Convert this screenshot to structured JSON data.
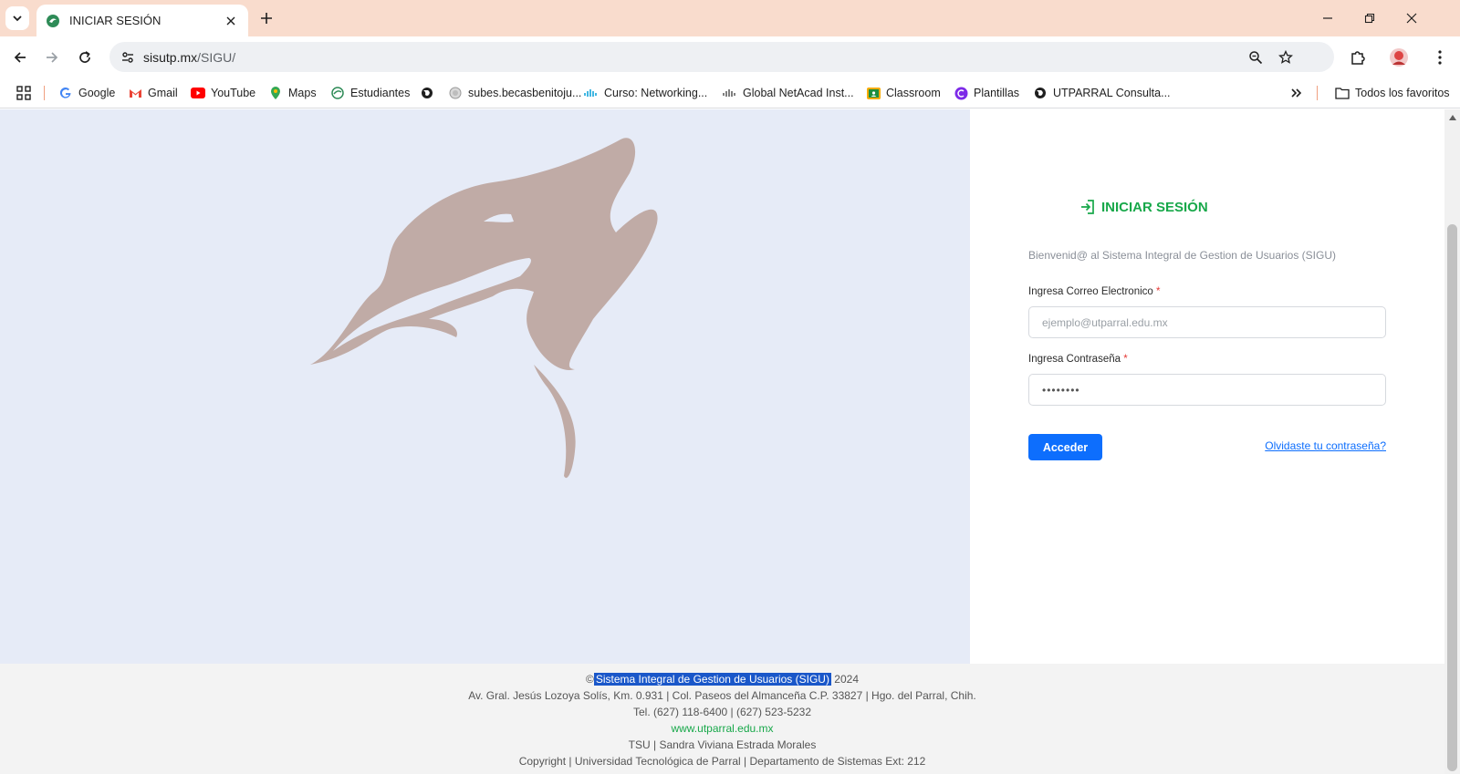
{
  "browser": {
    "tab_title": "INICIAR SESIÓN",
    "url_host": "sisutp.mx",
    "url_path": "/SIGU/",
    "bookmarks": [
      {
        "label": "Google",
        "icon": "google-icon"
      },
      {
        "label": "Gmail",
        "icon": "gmail-icon"
      },
      {
        "label": "YouTube",
        "icon": "youtube-icon"
      },
      {
        "label": "Maps",
        "icon": "maps-icon"
      },
      {
        "label": "Estudiantes",
        "icon": "utp-icon"
      },
      {
        "label": "",
        "icon": "globe-icon"
      },
      {
        "label": "subes.becasbenitoju...",
        "icon": "seal-icon"
      },
      {
        "label": "Curso: Networking...",
        "icon": "cisco-icon"
      },
      {
        "label": "Global NetAcad Inst...",
        "icon": "cisco-icon"
      },
      {
        "label": "Classroom",
        "icon": "classroom-icon"
      },
      {
        "label": "Plantillas",
        "icon": "canva-icon"
      },
      {
        "label": "UTPARRAL Consulta...",
        "icon": "globe-icon"
      }
    ],
    "all_bookmarks_label": "Todos los favoritos",
    "colors": {
      "tabbar": "#f9dccd",
      "omnibox": "#eef0f3"
    }
  },
  "login": {
    "title": "INICIAR SESIÓN",
    "welcome": "Bienvenid@ al Sistema Integral de Gestion de Usuarios (SIGU)",
    "email_label": "Ingresa Correo Electronico",
    "email_placeholder": "ejemplo@utparral.edu.mx",
    "email_value": "",
    "password_label": "Ingresa Contraseña",
    "password_value": "••••••••",
    "required_mark": "*",
    "submit_label": "Acceder",
    "forgot_label": "Olvidaste tu contraseña?",
    "colors": {
      "accent_green": "#18a84a",
      "button_blue": "#0d6efd",
      "hero_bg": "#e6ebf7",
      "logo": "#c0aba6"
    }
  },
  "footer": {
    "copyright_symbol": "©",
    "system_name": "Sistema Integral de Gestion de Usuarios (SIGU)",
    "year": "2024",
    "address": "Av. Gral. Jesús Lozoya Solís, Km. 0.931 | Col. Paseos del Almanceña C.P. 33827 | Hgo. del Parral, Chih.",
    "phones": "Tel. (627) 118-6400 | (627) 523-5232",
    "website": "www.utparral.edu.mx",
    "credit": "TSU | Sandra Viviana Estrada Morales",
    "copyright_line": "Copyright | Universidad Tecnológica de Parral | Departamento de Sistemas Ext: 212"
  }
}
